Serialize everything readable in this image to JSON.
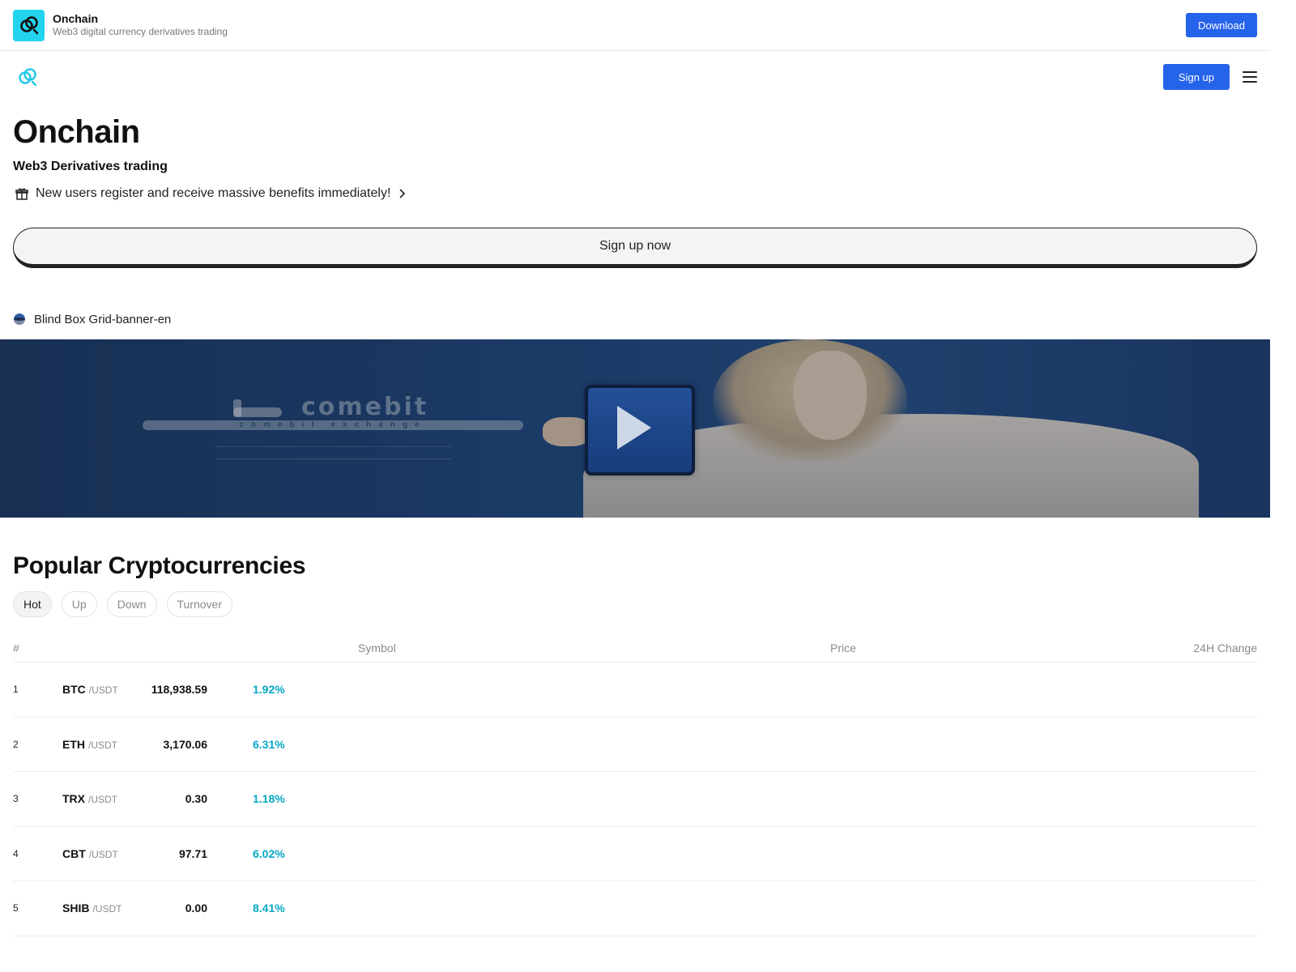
{
  "app_bar": {
    "title": "Onchain",
    "subtitle": "Web3 digital currency derivatives trading",
    "download_label": "Download",
    "logo_color": "#22d3ee"
  },
  "nav": {
    "signup_label": "Sign up",
    "logo_icon": "onchain-logo-icon",
    "menu_icon": "hamburger-menu-icon"
  },
  "hero": {
    "title": "Onchain",
    "subtitle": "Web3 Derivatives trading",
    "promo_text": "New users register and receive massive benefits immediately!",
    "signup_now_label": "Sign up now"
  },
  "banner": {
    "label": "Blind Box Grid-banner-en",
    "brand_name": "comebit",
    "brand_tagline": "comebit exchange"
  },
  "popular": {
    "title": "Popular Cryptocurrencies",
    "filters": [
      "Hot",
      "Up",
      "Down",
      "Turnover"
    ],
    "active_filter": "Hot",
    "columns": {
      "num": "#",
      "symbol": "Symbol",
      "price": "Price",
      "change": "24H Change"
    },
    "rows": [
      {
        "rank": "1",
        "symbol": "BTC",
        "quote": "/USDT",
        "price": "118,938.59",
        "change": "1.92%"
      },
      {
        "rank": "2",
        "symbol": "ETH",
        "quote": "/USDT",
        "price": "3,170.06",
        "change": "6.31%"
      },
      {
        "rank": "3",
        "symbol": "TRX",
        "quote": "/USDT",
        "price": "0.30",
        "change": "1.18%"
      },
      {
        "rank": "4",
        "symbol": "CBT",
        "quote": "/USDT",
        "price": "97.71",
        "change": "6.02%"
      },
      {
        "rank": "5",
        "symbol": "SHIB",
        "quote": "/USDT",
        "price": "0.00",
        "change": "8.41%"
      }
    ]
  },
  "colors": {
    "primary": "#2563eb",
    "positive": "#06a8c4",
    "text": "#111111",
    "muted": "#8a8a8a"
  }
}
